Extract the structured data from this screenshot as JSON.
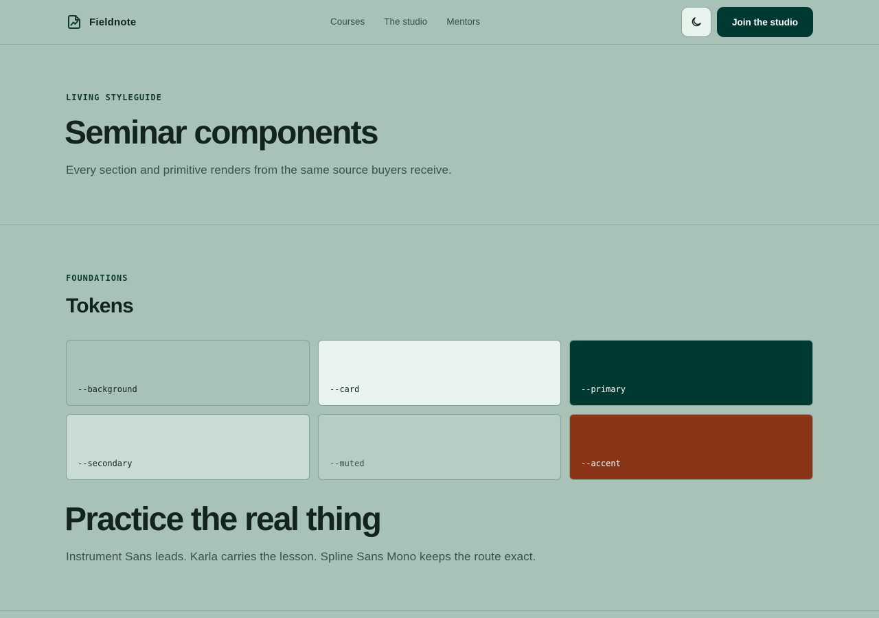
{
  "header": {
    "brand": "Fieldnote",
    "brand_icon": "chart-file-icon",
    "nav": [
      "Courses",
      "The studio",
      "Mentors"
    ],
    "theme_toggle_icon": "moon-icon",
    "cta_label": "Join the studio"
  },
  "hero": {
    "eyebrow": "LIVING STYLEGUIDE",
    "title": "Seminar components",
    "subtitle": "Every section and primitive renders from the same source buyers receive."
  },
  "foundations": {
    "eyebrow": "FOUNDATIONS",
    "title": "Tokens",
    "tokens": [
      {
        "name": "--background",
        "color": "#a8c2b7",
        "text_color": "#13231d"
      },
      {
        "name": "--card",
        "color": "#e8f3ee",
        "text_color": "#13231d"
      },
      {
        "name": "--primary",
        "color": "#003931",
        "text_color": "#ffffff"
      },
      {
        "name": "--secondary",
        "color": "#c9dcd4",
        "text_color": "#13231d"
      },
      {
        "name": "--muted",
        "color": "#b6cdc3",
        "text_color": "#3a5148"
      },
      {
        "name": "--accent",
        "color": "#8b3518",
        "text_color": "#ffffff"
      }
    ]
  },
  "typography": {
    "title": "Practice the real thing",
    "subtitle": "Instrument Sans leads. Karla carries the lesson. Spline Sans Mono keeps the route exact."
  }
}
